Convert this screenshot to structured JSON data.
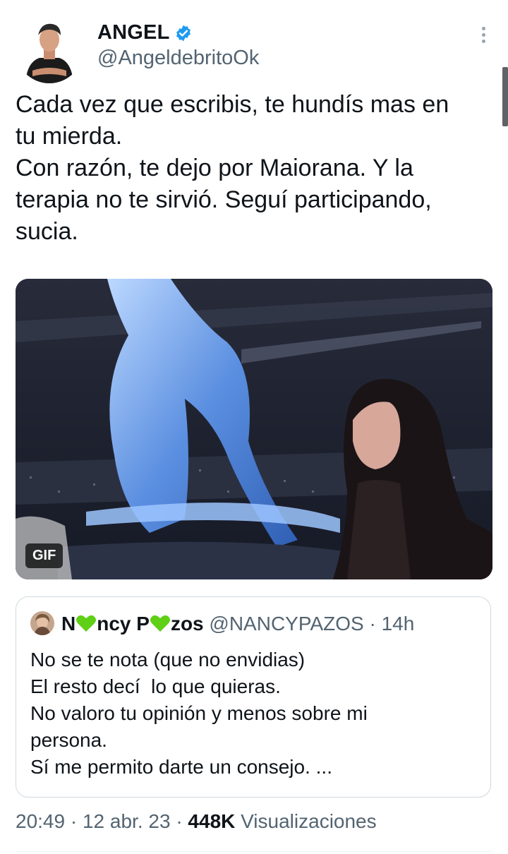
{
  "author": {
    "name": "ANGEL",
    "handle": "@AngeldebritoOk",
    "verified_color": "#1d9bf0"
  },
  "tweet": {
    "text": "Cada vez que escribis, te hundís mas en\ntu mierda.\nCon razón, te dejo por Maiorana. Y la\nterapia no te sirvió. Seguí participando,\nsucia."
  },
  "media": {
    "badge": "GIF"
  },
  "quote": {
    "name_part1": "N",
    "name_part2": "ncy P",
    "name_part3": "zos",
    "handle": "@NANCYPAZOS",
    "separator": "·",
    "time": "14h",
    "text": "No se te nota (que no envidias)\nEl resto decí  lo que quieras.\nNo valoro tu opinión y menos sobre mi\npersona.\nSí me permito darte un consejo. ...",
    "heart_color": "#5fd016"
  },
  "footer": {
    "time": "20:49",
    "separator": "·",
    "date": "12 abr. 23",
    "views_count": "448K",
    "views_label": "Visualizaciones"
  }
}
